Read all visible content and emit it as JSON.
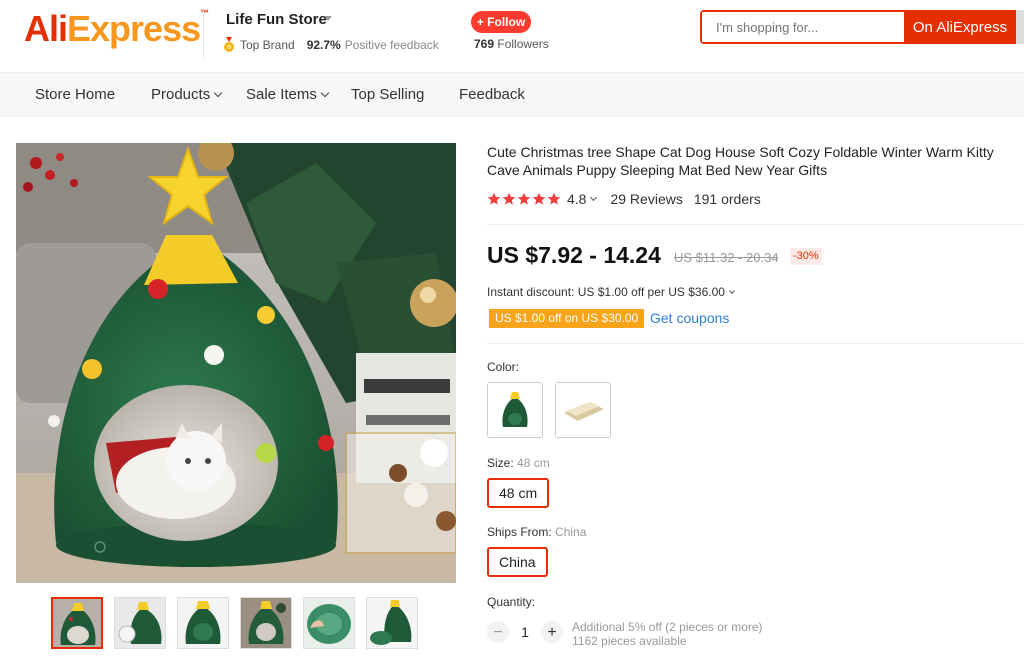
{
  "header": {
    "logo_ali": "Ali",
    "logo_express": "Express",
    "logo_tm": "™",
    "store_name": "Life Fun Store",
    "top_brand": "Top Brand",
    "feedback_pct": "92.7%",
    "feedback_label": "Positive feedback",
    "follow_label": "+ Follow",
    "followers_count": "769",
    "followers_label": "Followers",
    "search_placeholder": "I'm shopping for...",
    "search_button": "On AliExpress"
  },
  "nav": {
    "items": [
      "Store Home",
      "Products",
      "Sale Items",
      "Top Selling",
      "Feedback"
    ]
  },
  "product": {
    "title": "Cute Christmas tree Shape Cat Dog House Soft Cozy Foldable Winter Warm Kitty Cave Animals Puppy Sleeping Mat Bed New Year Gifts",
    "rating": "4.8",
    "reviews": "29 Reviews",
    "orders": "191 orders",
    "stars": 5,
    "price": "US $7.92 - 14.24",
    "original_price": "US $11.32 - 20.34",
    "discount": "-30%",
    "instant_discount": "Instant discount: US $1.00 off per US $36.00",
    "coupon_tag": "US $1.00 off on US $30.00",
    "get_coupons": "Get coupons",
    "color_label": "Color:",
    "size_label": "Size:",
    "size_value": "48 cm",
    "size_option": "48 cm",
    "ships_label": "Ships From:",
    "ships_value": "China",
    "ships_option": "China",
    "quantity_label": "Quantity:",
    "quantity": "1",
    "qty_minus": "−",
    "qty_plus": "+",
    "qty_note_1": "Additional 5% off (2 pieces or more)",
    "qty_note_2": "1162 pieces available"
  },
  "colors": {
    "brand": "#e62e04",
    "brand_orange": "#f7971e",
    "coupon": "#f8a41b",
    "link": "#2f7fd6",
    "star": "#f03d3d"
  }
}
